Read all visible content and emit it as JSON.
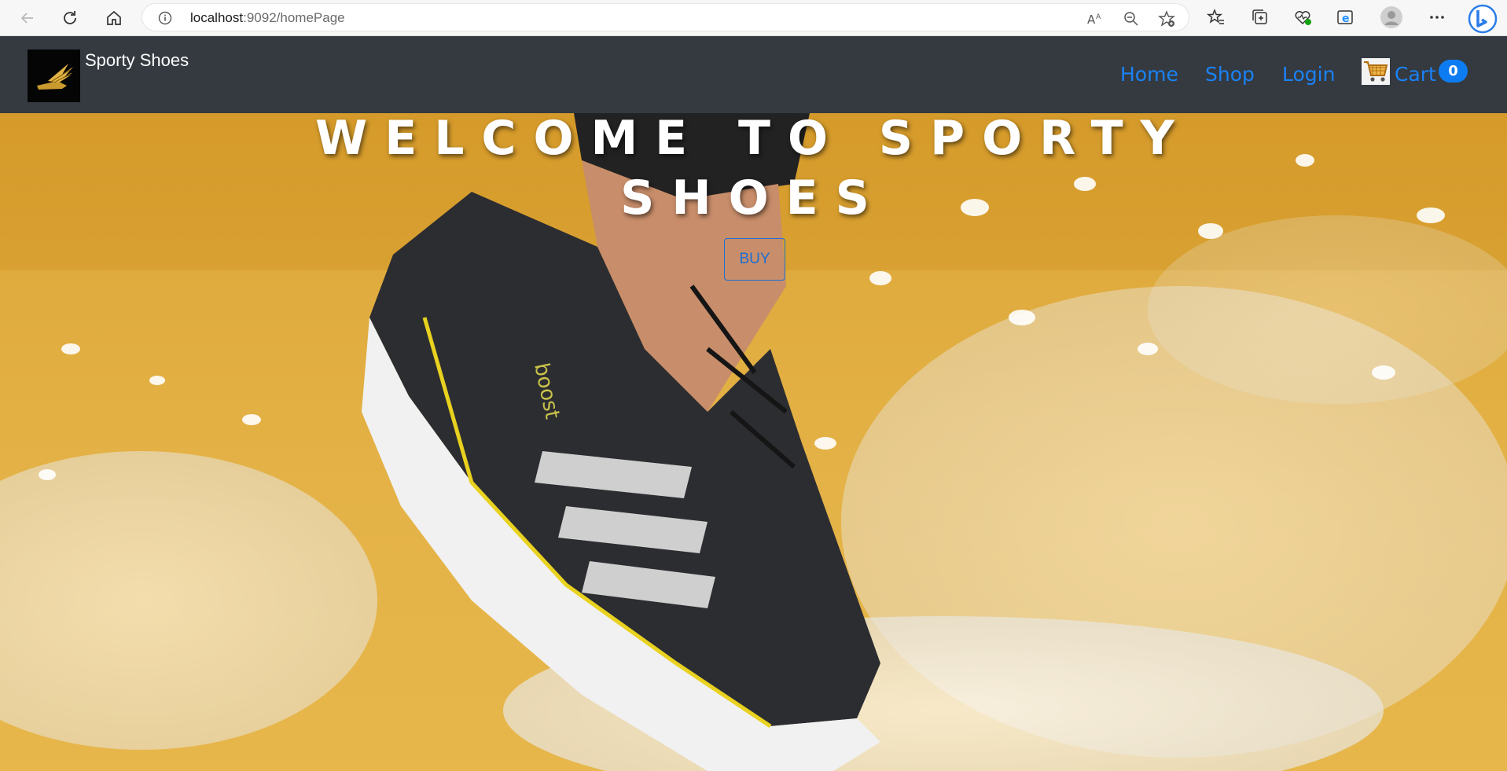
{
  "browser": {
    "url_host": "localhost",
    "url_path": ":9092/homePage"
  },
  "site": {
    "brand_name": "Sporty Shoes",
    "nav": {
      "home": "Home",
      "shop": "Shop",
      "login": "Login",
      "cart": "Cart",
      "cart_count": "0"
    }
  },
  "hero": {
    "title_line1": "WELCOME TO SPORTY",
    "title_line2": "SHOES",
    "buy_label": "BUY"
  },
  "colors": {
    "nav_bg": "#343a40",
    "link": "#1a82f7",
    "badge": "#0d7cf2",
    "hero_bg": "#d9a233"
  }
}
